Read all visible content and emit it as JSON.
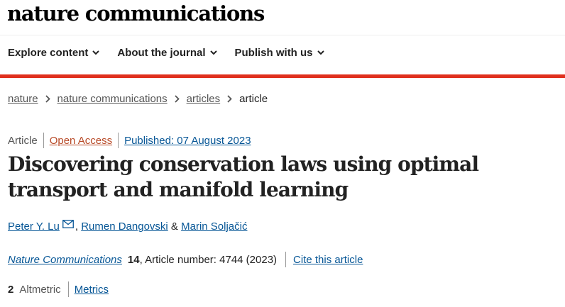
{
  "header": {
    "logo": "nature communications"
  },
  "nav": [
    {
      "label": "Explore content"
    },
    {
      "label": "About the journal"
    },
    {
      "label": "Publish with us"
    }
  ],
  "breadcrumb": [
    {
      "label": "nature"
    },
    {
      "label": "nature communications"
    },
    {
      "label": "articles"
    },
    {
      "label": "article"
    }
  ],
  "meta": {
    "type": "Article",
    "access": "Open Access",
    "published": "Published: 07 August 2023"
  },
  "title": "Discovering conservation laws using optimal transport and manifold learning",
  "authors": {
    "first": "Peter Y. Lu",
    "comma": ",",
    "second": "Rumen Dangovski",
    "amp": "&",
    "third": "Marin Soljačić"
  },
  "citation": {
    "journal": "Nature Communications",
    "volume": "14",
    "article_number": ", Article number: 4744 (2023)",
    "cite_label": "Cite this article"
  },
  "metrics": {
    "altmetric_count": "2",
    "altmetric_label": "Altmetric",
    "metrics_label": "Metrics"
  },
  "colors": {
    "accent_red": "#e0301e",
    "link_blue": "#065696",
    "open_access": "#b84a27"
  }
}
